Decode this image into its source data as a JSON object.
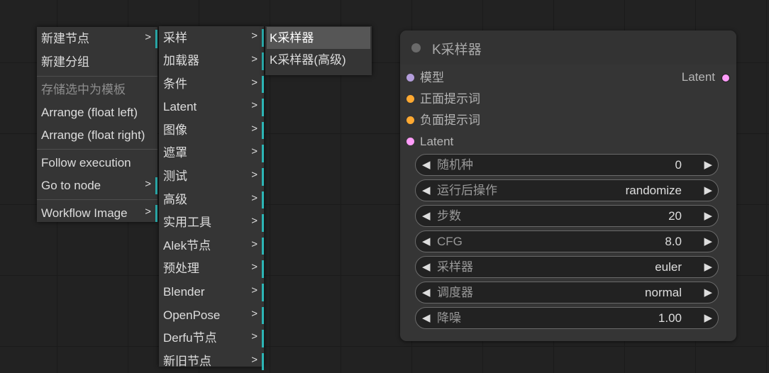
{
  "menu1": {
    "items": [
      {
        "label": "新建节点",
        "has_submenu": true
      },
      {
        "label": "新建分组"
      },
      {
        "label": "存储选中为模板",
        "disabled": true
      },
      {
        "label": "Arrange (float left)"
      },
      {
        "label": "Arrange (float right)"
      },
      {
        "label": "Follow execution"
      },
      {
        "label": "Go to node",
        "has_submenu": true
      },
      {
        "label": "Workflow Image",
        "has_submenu": true
      }
    ]
  },
  "menu2": {
    "arrow": ">",
    "items": [
      "采样",
      "加载器",
      "条件",
      "Latent",
      "图像",
      "遮罩",
      "测试",
      "高级",
      "实用工具",
      "Alek节点",
      "预处理",
      "Blender",
      "OpenPose",
      "Derfu节点",
      "新旧节点"
    ]
  },
  "menu3": {
    "items": [
      {
        "label": "K采样器",
        "selected": true
      },
      {
        "label": "K采样器(高级)"
      }
    ]
  },
  "node": {
    "title": "K采样器",
    "inputs": [
      {
        "label": "模型",
        "color": "#b39ddb"
      },
      {
        "label": "正面提示词",
        "color": "#ffa931"
      },
      {
        "label": "负面提示词",
        "color": "#ffa931"
      },
      {
        "label": "Latent",
        "color": "#ff9cf9"
      }
    ],
    "output": {
      "label": "Latent",
      "color": "#ff9cf9"
    },
    "widgets": [
      {
        "label": "随机种",
        "value": "0"
      },
      {
        "label": "运行后操作",
        "value": "randomize"
      },
      {
        "label": "步数",
        "value": "20"
      },
      {
        "label": "CFG",
        "value": "8.0"
      },
      {
        "label": "采样器",
        "value": "euler"
      },
      {
        "label": "调度器",
        "value": "normal"
      },
      {
        "label": "降噪",
        "value": "1.00"
      }
    ],
    "arrow_left": "◀",
    "arrow_right": "▶"
  }
}
